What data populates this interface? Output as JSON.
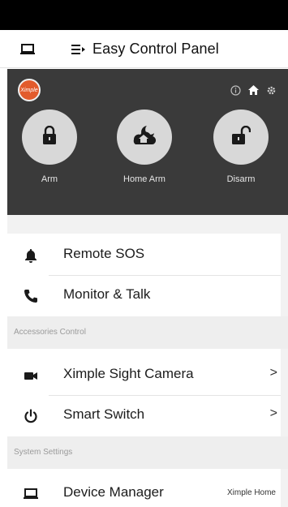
{
  "app": {
    "title": "Easy Control Panel",
    "logo_text": "Ximple"
  },
  "modes": [
    {
      "label": "Arm",
      "icon": "lock-closed-icon"
    },
    {
      "label": "Home Arm",
      "icon": "home-moon-icon"
    },
    {
      "label": "Disarm",
      "icon": "lock-open-icon"
    }
  ],
  "header_icons": [
    "info-icon",
    "home-icon",
    "gear-icon"
  ],
  "items": {
    "remote_sos": "Remote SOS",
    "monitor_talk": "Monitor & Talk",
    "camera": "Ximple Sight Camera",
    "smart_switch": "Smart Switch",
    "device_manager": "Device Manager"
  },
  "sections": {
    "accessories": "Accessories Control",
    "system": "System Settings"
  },
  "device_manager_value": "Ximple Home",
  "chevron": ">",
  "colors": {
    "panel_bg": "#3a3a3a",
    "logo": "#e25b2c",
    "mode_circle": "#d8d8d8"
  }
}
